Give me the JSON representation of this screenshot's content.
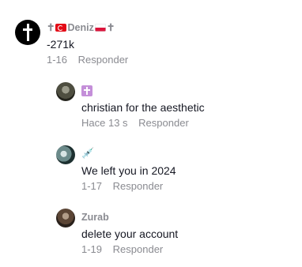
{
  "comments": [
    {
      "author_prefix": "✝",
      "author": "Deniz",
      "author_suffix": "✝",
      "text": "-271k",
      "time": "1-16",
      "reply": "Responder"
    },
    {
      "author": "",
      "text": "christian for the aesthetic",
      "time": "Hace 13 s",
      "reply": "Responder"
    },
    {
      "author_icon": "💉",
      "text": "We left you in 2024",
      "time": "1-17",
      "reply": "Responder"
    },
    {
      "author": "Zurab",
      "text": "delete your account",
      "time": "1-19",
      "reply": "Responder"
    }
  ],
  "icons": {
    "main_avatar": "cross-icon",
    "flag_left": "turkey-flag-icon",
    "flag_right": "poland-flag-icon",
    "reply1_author": "cross-box-icon",
    "reply2_author": "syringe-icon"
  },
  "colors": {
    "text": "#161823",
    "secondary": "#8a8b91",
    "cross_box": "#c48fd9"
  }
}
